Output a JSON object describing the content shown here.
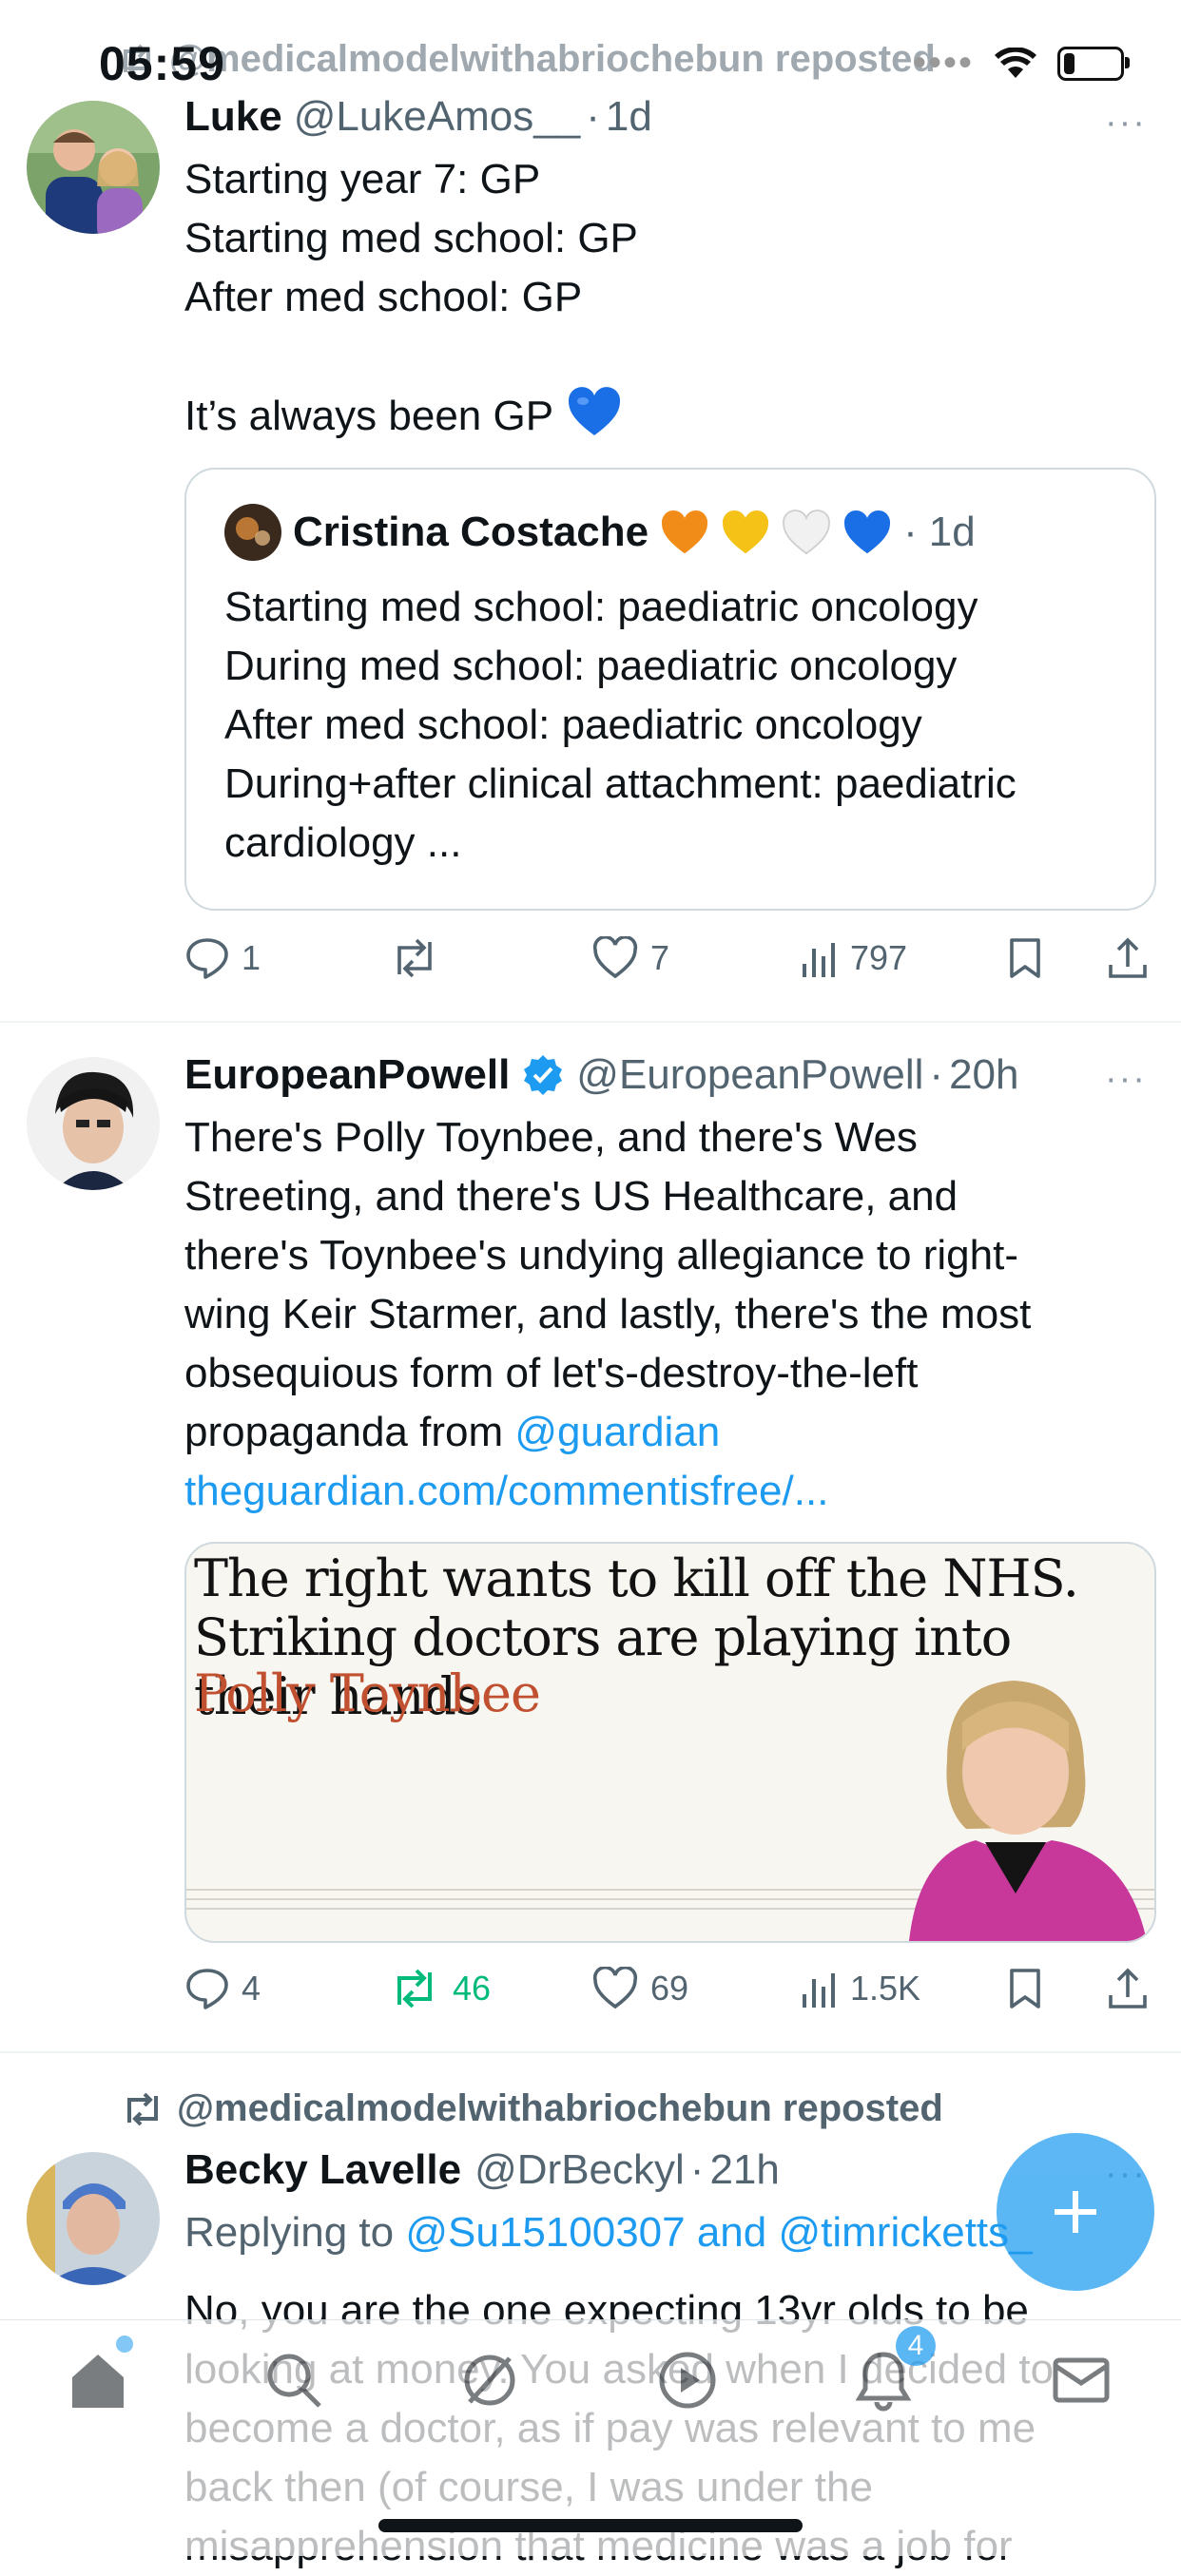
{
  "status_bar": {
    "time": "05:59",
    "battery_level": 0.22
  },
  "top_repost": {
    "text": "@medicalmodelwithabriochebun reposted"
  },
  "tweet1": {
    "name": "Luke",
    "handle": "@LukeAmos__",
    "dot": "·",
    "time": "1d",
    "more": "···",
    "body": "Starting year 7: GP\nStarting med school: GP\nAfter med school: GP\n\nIt’s always been GP",
    "quote": {
      "name": "Cristina Costache",
      "dot": "·",
      "time": "1d",
      "body": "Starting med school: paediatric oncology\nDuring med school: paediatric oncology\nAfter med school: paediatric oncology\nDuring+after clinical attachment: paediatric\ncardiology ..."
    },
    "actions": {
      "replies": "1",
      "reposts": "",
      "likes": "7",
      "views": "797"
    }
  },
  "tweet2": {
    "name": "EuropeanPowell",
    "handle": "@EuropeanPowell",
    "dot": "·",
    "time": "20h",
    "more": "···",
    "body": "There's Polly Toynbee, and there's Wes\nStreeting, and there's US Healthcare, and\nthere's Toynbee's undying allegiance to right-\nwing Keir Starmer, and lastly, there's the most\nobsequious form of let's-destroy-the-left\npropaganda from ",
    "mention": "@guardian",
    "link": "theguardian.com/commentisfree/...",
    "card": {
      "headline": "The right wants to kill off the NHS. Striking doctors are playing into their hands",
      "byline": "Polly Toynbee"
    },
    "actions": {
      "replies": "4",
      "reposts": "46",
      "likes": "69",
      "views": "1.5K"
    }
  },
  "tweet3": {
    "repost_text": "@medicalmodelwithabriochebun reposted",
    "name": "Becky Lavelle",
    "handle": "@DrBeckyl",
    "dot": "·",
    "time": "21h",
    "more": "···",
    "replying_prefix": "Replying to ",
    "replying_to": "@Su15100307 and @timricketts_",
    "body": "No, you are the one expecting 13yr olds to be\nlooking at money. You asked when I decided to\nbecome a doctor, as if pay was relevant to me\nback then (of course, I was under the\nmisapprehension that medicine was a job for"
  },
  "tabbar": {
    "notifications_badge": "4"
  },
  "colors": {
    "accent": "#1d9bf0",
    "repost_green": "#00ba7c",
    "secondary_text": "#536471"
  }
}
